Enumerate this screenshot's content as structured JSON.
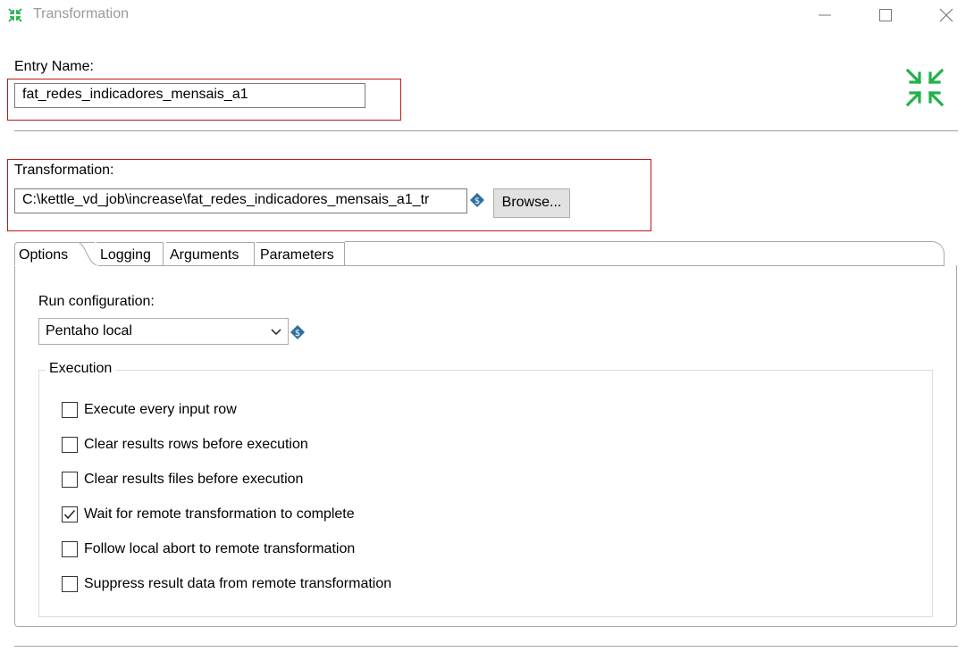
{
  "window": {
    "title": "Transformation",
    "minimize_icon": "minimize-icon",
    "maximize_icon": "maximize-icon",
    "close_icon": "close-icon",
    "app_icon": "transformation-icon"
  },
  "entry": {
    "label": "Entry Name:",
    "value": "fat_redes_indicadores_mensais_a1"
  },
  "transformation": {
    "label": "Transformation:",
    "path_value": "C:\\kettle_vd_job\\increase\\fat_redes_indicadores_mensais_a1_tr",
    "browse_label": "Browse..."
  },
  "tabs": [
    {
      "label": "Options",
      "active": true
    },
    {
      "label": "Logging",
      "active": false
    },
    {
      "label": "Arguments",
      "active": false
    },
    {
      "label": "Parameters",
      "active": false
    }
  ],
  "options": {
    "run_config_label": "Run configuration:",
    "run_config_value": "Pentaho local",
    "execution_legend": "Execution",
    "checkboxes": [
      {
        "label": "Execute every input row",
        "checked": false
      },
      {
        "label": "Clear results rows before execution",
        "checked": false
      },
      {
        "label": "Clear results files before execution",
        "checked": false
      },
      {
        "label": "Wait for remote transformation to complete",
        "checked": true
      },
      {
        "label": "Follow local abort to remote transformation",
        "checked": false
      },
      {
        "label": "Suppress result data from remote transformation",
        "checked": false
      }
    ]
  },
  "colors": {
    "accent_green": "#22b14c",
    "highlight_red": "#c01818",
    "variable_icon": "#2f6e9e"
  }
}
